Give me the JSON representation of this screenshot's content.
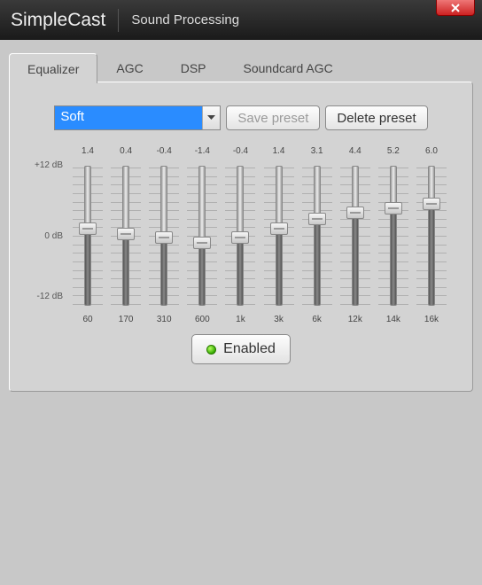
{
  "window": {
    "title_main": "SimpleCast",
    "title_sub": "Sound Processing"
  },
  "tabs": [
    {
      "label": "Equalizer",
      "active": true
    },
    {
      "label": "AGC",
      "active": false
    },
    {
      "label": "DSP",
      "active": false
    },
    {
      "label": "Soundcard AGC",
      "active": false
    }
  ],
  "preset": {
    "selected": "Soft",
    "save_label": "Save preset",
    "delete_label": "Delete preset"
  },
  "scale": {
    "top": "+12 dB",
    "mid": "0 dB",
    "bot": "-12 dB"
  },
  "bands": [
    {
      "value": "1.4",
      "freq": "60"
    },
    {
      "value": "0.4",
      "freq": "170"
    },
    {
      "value": "-0.4",
      "freq": "310"
    },
    {
      "value": "-1.4",
      "freq": "600"
    },
    {
      "value": "-0.4",
      "freq": "1k"
    },
    {
      "value": "1.4",
      "freq": "3k"
    },
    {
      "value": "3.1",
      "freq": "6k"
    },
    {
      "value": "4.4",
      "freq": "12k"
    },
    {
      "value": "5.2",
      "freq": "14k"
    },
    {
      "value": "6.0",
      "freq": "16k"
    }
  ],
  "enabled_label": "Enabled"
}
